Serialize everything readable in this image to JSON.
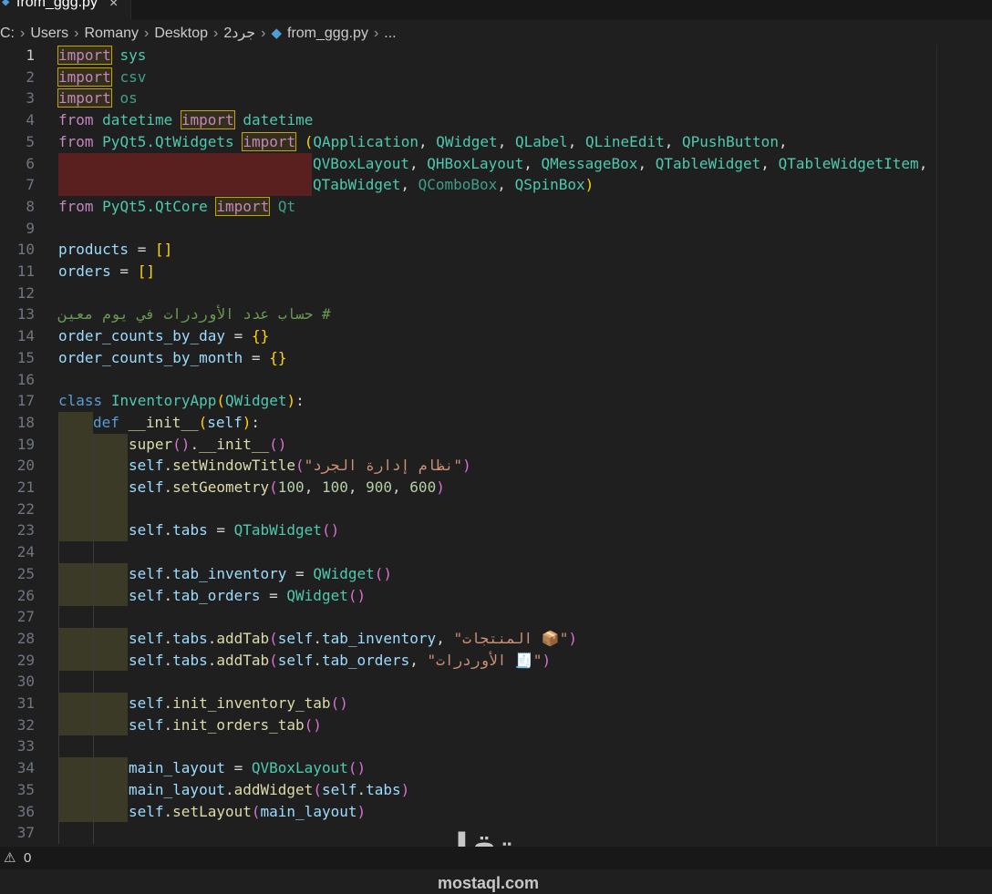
{
  "tab": {
    "icon": "python-file-icon",
    "label": "from_ggg.py",
    "close": "×"
  },
  "breadcrumb": [
    "C:",
    "Users",
    "Romany",
    "Desktop",
    "2جرد",
    "from_ggg.py",
    "..."
  ],
  "status": {
    "warnings": "0"
  },
  "watermark": {
    "arabic": "مستقل",
    "latin": "mostaql.com"
  },
  "code": {
    "l1": [
      "import",
      "sys"
    ],
    "l2": [
      "import",
      "csv"
    ],
    "l3": [
      "import",
      "os"
    ],
    "l4": [
      "from",
      "datetime",
      "import",
      "datetime"
    ],
    "l5": [
      "from",
      "PyQt5.QtWidgets",
      "import",
      "(",
      "QApplication",
      "QWidget",
      "QLabel",
      "QLineEdit",
      "QPushButton"
    ],
    "l6": [
      "QVBoxLayout",
      "QHBoxLayout",
      "QMessageBox",
      "QTableWidget",
      "QTableWidgetItem"
    ],
    "l7": [
      "QTabWidget",
      "QComboBox",
      "QSpinBox",
      ")"
    ],
    "l8": [
      "from",
      "PyQt5.QtCore",
      "import",
      "Qt"
    ],
    "l10": [
      "products",
      "[]"
    ],
    "l11": [
      "orders",
      "[]"
    ],
    "l13": "# حساب عدد الأوردرات في يوم معين",
    "l14": [
      "order_counts_by_day",
      "{}"
    ],
    "l15": [
      "order_counts_by_month",
      "{}"
    ],
    "l17": [
      "class",
      "InventoryApp",
      "QWidget"
    ],
    "l18": [
      "def",
      "__init__",
      "self"
    ],
    "l19": [
      "super",
      "__init__"
    ],
    "l20": [
      "self",
      "setWindowTitle",
      "\"نظام إدارة الجرد\""
    ],
    "l21": [
      "self",
      "setGeometry",
      "100",
      "100",
      "900",
      "600"
    ],
    "l23": [
      "self",
      "tabs",
      "QTabWidget"
    ],
    "l25": [
      "self",
      "tab_inventory",
      "QWidget"
    ],
    "l26": [
      "self",
      "tab_orders",
      "QWidget"
    ],
    "l28": [
      "self",
      "tabs",
      "addTab",
      "self",
      "tab_inventory",
      "\"📦 المنتجات\""
    ],
    "l29": [
      "self",
      "tabs",
      "addTab",
      "self",
      "tab_orders",
      "\"🧾 الأوردرات\""
    ],
    "l31": [
      "self",
      "init_inventory_tab"
    ],
    "l32": [
      "self",
      "init_orders_tab"
    ],
    "l34": [
      "main_layout",
      "QVBoxLayout"
    ],
    "l35": [
      "main_layout",
      "addWidget",
      "self",
      "tabs"
    ],
    "l36": [
      "self",
      "setLayout",
      "main_layout"
    ]
  },
  "line_numbers": [
    "1",
    "2",
    "3",
    "4",
    "5",
    "6",
    "7",
    "8",
    "9",
    "10",
    "11",
    "12",
    "13",
    "14",
    "15",
    "16",
    "17",
    "18",
    "19",
    "20",
    "21",
    "22",
    "23",
    "24",
    "25",
    "26",
    "27",
    "28",
    "29",
    "30",
    "31",
    "32",
    "33",
    "34",
    "35",
    "36",
    "37"
  ]
}
